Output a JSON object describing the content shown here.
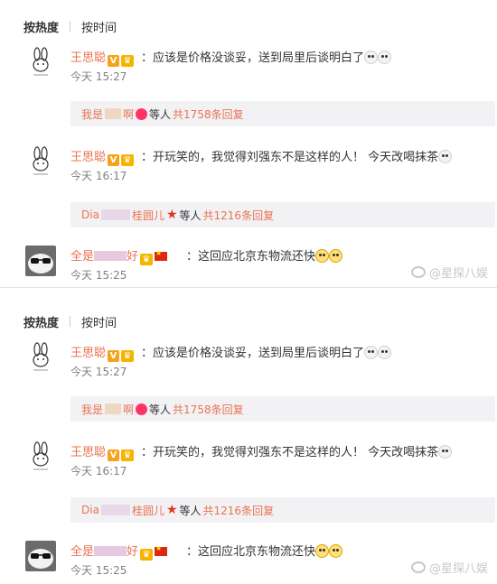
{
  "sort_bar": {
    "hot": "按热度",
    "time": "按时间"
  },
  "comments": [
    {
      "username": "王思聪",
      "text_before": "：应该是价格没谈妥，送到局里后谈明白了",
      "timestamp": "今天 15:27",
      "replies": {
        "prefix": "我是",
        "suffix": "啊",
        "mid": "等人",
        "total": "共1758条回复"
      }
    },
    {
      "username": "王思聪",
      "text_before": "：开玩笑的，我觉得刘强东不是这样的人！ 今天改喝抹茶",
      "timestamp": "今天 16:17",
      "replies": {
        "prefix": "Dia",
        "suffix": "桂圆儿",
        "mid": "等人",
        "total": "共1216条回复"
      }
    },
    {
      "username_prefix": "全是",
      "username_suffix": "好",
      "text_before": "：这回应北京东物流还快",
      "timestamp": "今天 15:25"
    }
  ],
  "watermark": "@星探八娱",
  "colors": {
    "accent": "#eb7350",
    "reply_bg": "#f2f2f5",
    "timestamp": "#808080"
  },
  "icons": [
    "verified-v-icon",
    "crown-icon",
    "emoji-icon",
    "flower-icon",
    "star-icon",
    "china-flag-icon",
    "weibo-icon"
  ]
}
